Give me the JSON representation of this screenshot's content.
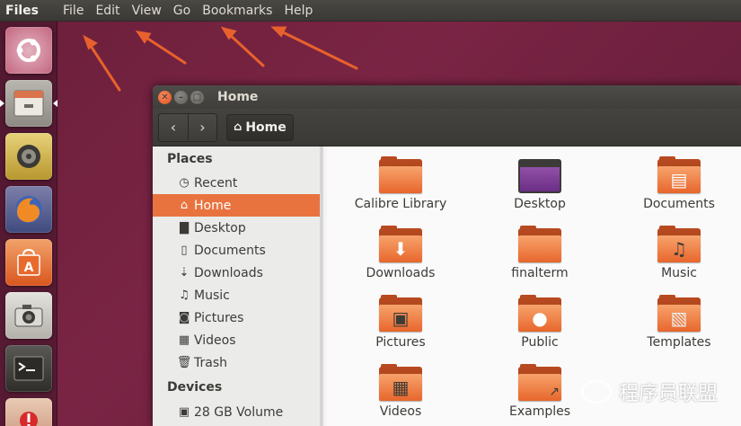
{
  "topbar": {
    "app_name": "Files",
    "menu": [
      "File",
      "Edit",
      "View",
      "Go",
      "Bookmarks",
      "Help"
    ]
  },
  "launcher": {
    "items": [
      {
        "icon": "ubuntu-dash-icon"
      },
      {
        "icon": "files-icon"
      },
      {
        "icon": "rhythmbox-icon"
      },
      {
        "icon": "firefox-icon"
      },
      {
        "icon": "software-center-icon"
      },
      {
        "icon": "camera-icon"
      },
      {
        "icon": "terminal-icon"
      },
      {
        "icon": "updates-icon"
      }
    ]
  },
  "window": {
    "title": "Home",
    "breadcrumb": "Home",
    "nav": {
      "back": "‹",
      "forward": "›"
    }
  },
  "sidebar": {
    "places_title": "Places",
    "places": [
      {
        "label": "Recent",
        "icon": "clock-icon",
        "active": false
      },
      {
        "label": "Home",
        "icon": "home-icon",
        "active": true
      },
      {
        "label": "Desktop",
        "icon": "desktop-folder-icon",
        "active": false
      },
      {
        "label": "Documents",
        "icon": "document-icon",
        "active": false
      },
      {
        "label": "Downloads",
        "icon": "download-icon",
        "active": false
      },
      {
        "label": "Music",
        "icon": "music-icon",
        "active": false
      },
      {
        "label": "Pictures",
        "icon": "camera-icon",
        "active": false
      },
      {
        "label": "Videos",
        "icon": "film-icon",
        "active": false
      },
      {
        "label": "Trash",
        "icon": "trash-icon",
        "active": false
      }
    ],
    "devices_title": "Devices",
    "devices": [
      {
        "label": "28 GB Volume",
        "icon": "drive-icon"
      }
    ]
  },
  "files": [
    {
      "label": "Calibre Library",
      "emblem": ""
    },
    {
      "label": "Desktop",
      "emblem": "desktop"
    },
    {
      "label": "Documents",
      "emblem": "document"
    },
    {
      "label": "Downloads",
      "emblem": "download"
    },
    {
      "label": "finalterm",
      "emblem": ""
    },
    {
      "label": "Music",
      "emblem": "music"
    },
    {
      "label": "Pictures",
      "emblem": "picture"
    },
    {
      "label": "Public",
      "emblem": "person"
    },
    {
      "label": "Templates",
      "emblem": "template"
    },
    {
      "label": "Videos",
      "emblem": "film"
    },
    {
      "label": "Examples",
      "emblem": "link"
    }
  ],
  "watermark": {
    "text": "程序员联盟"
  },
  "colors": {
    "accent": "#e9733f",
    "desktop": "#6b1f3a",
    "panel": "#3c3b37"
  }
}
